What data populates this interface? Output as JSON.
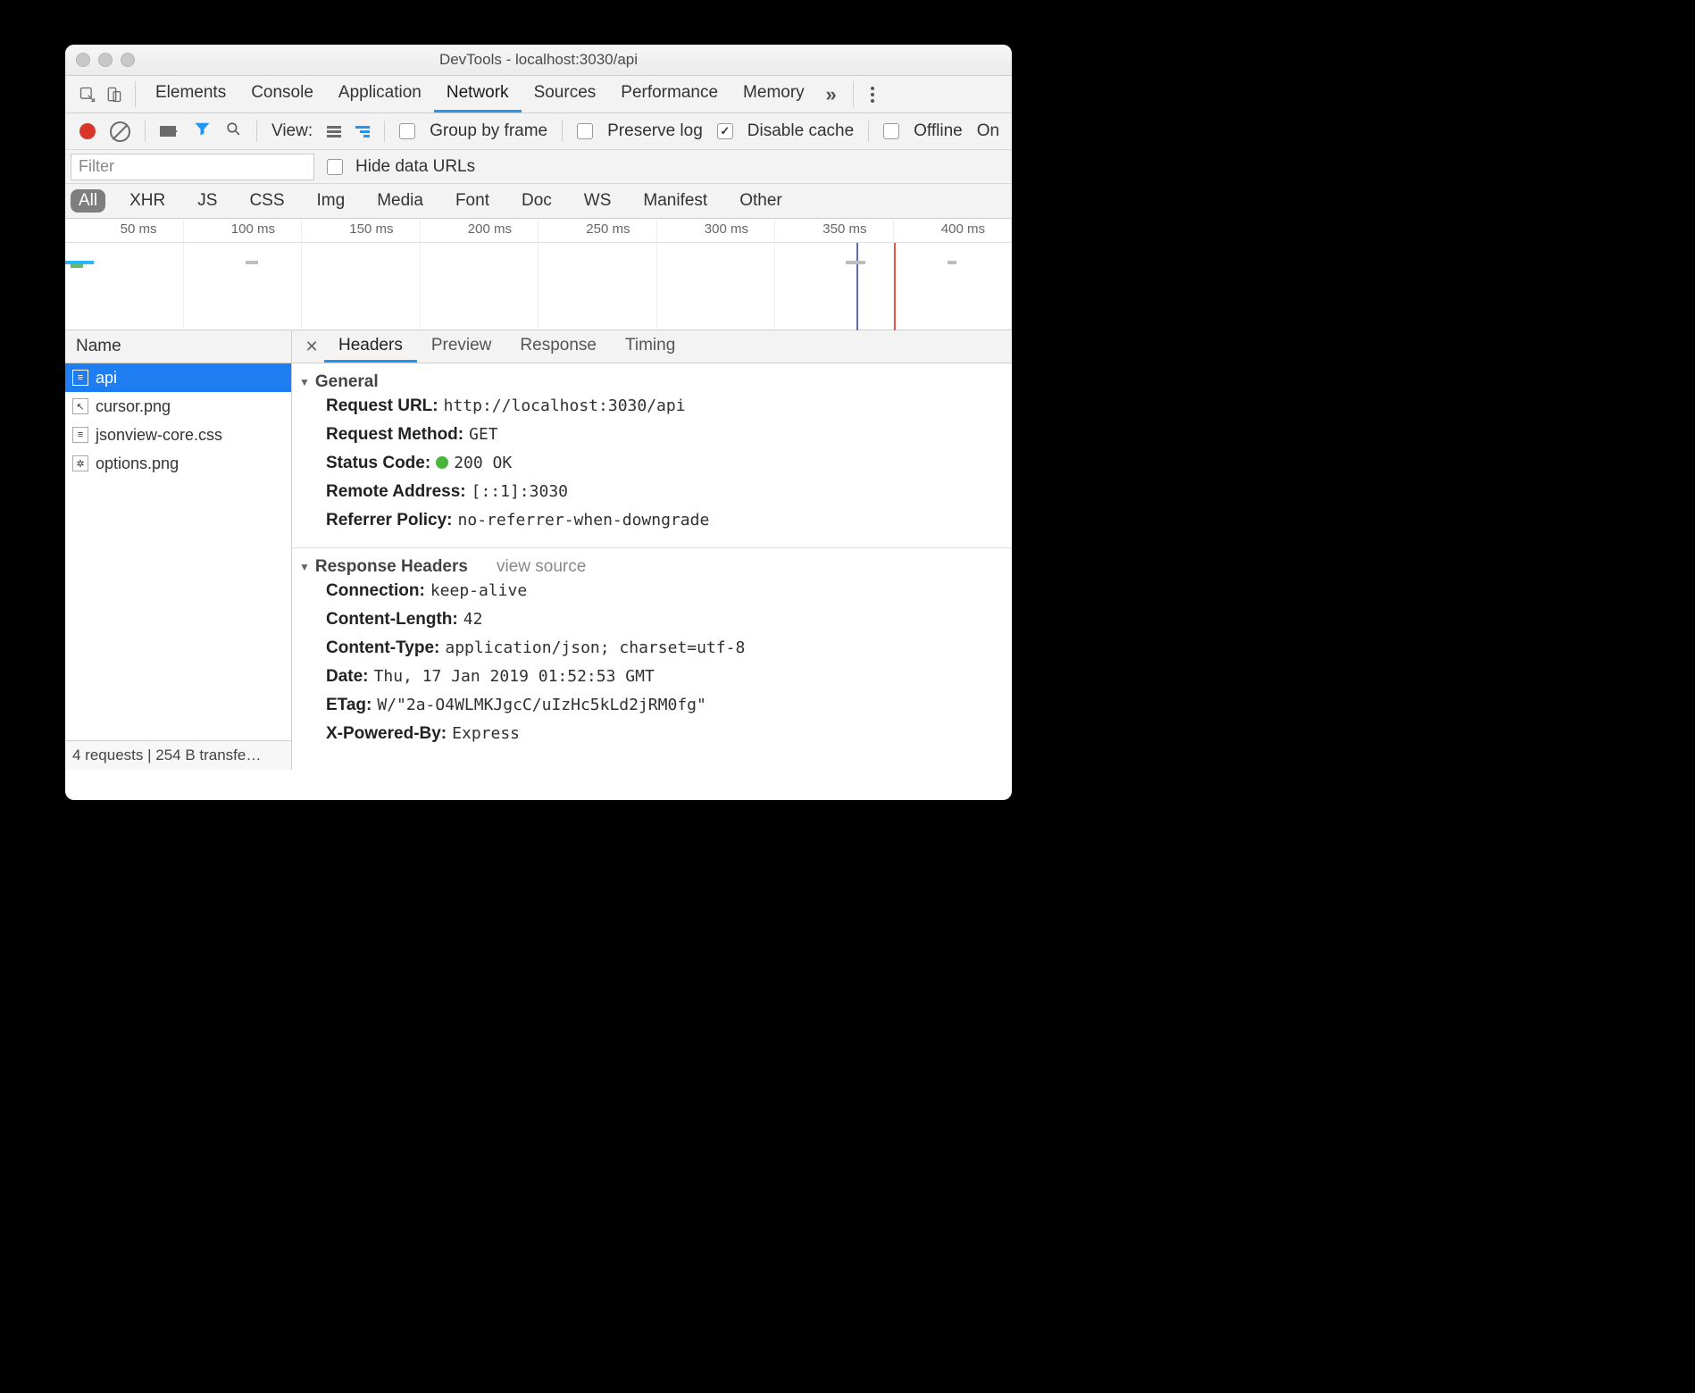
{
  "window": {
    "title": "DevTools - localhost:3030/api"
  },
  "toptabs": {
    "items": [
      "Elements",
      "Console",
      "Application",
      "Network",
      "Sources",
      "Performance",
      "Memory"
    ],
    "active": 3
  },
  "toolbar": {
    "view_label": "View:",
    "group_by_frame": "Group by frame",
    "preserve_log": "Preserve log",
    "disable_cache": "Disable cache",
    "offline": "Offline",
    "online": "On"
  },
  "filter": {
    "placeholder": "Filter",
    "hide_data_urls": "Hide data URLs"
  },
  "types": {
    "items": [
      "All",
      "XHR",
      "JS",
      "CSS",
      "Img",
      "Media",
      "Font",
      "Doc",
      "WS",
      "Manifest",
      "Other"
    ],
    "active": 0
  },
  "timeline": {
    "ticks": [
      "50 ms",
      "100 ms",
      "150 ms",
      "200 ms",
      "250 ms",
      "300 ms",
      "350 ms",
      "400 ms"
    ]
  },
  "leftpanel": {
    "header": "Name",
    "rows": [
      {
        "icon": "doc",
        "name": "api"
      },
      {
        "icon": "cursor",
        "name": "cursor.png"
      },
      {
        "icon": "doc",
        "name": "jsonview-core.css"
      },
      {
        "icon": "gear",
        "name": "options.png"
      }
    ],
    "selected": 0,
    "footer": "4 requests | 254 B transfe…"
  },
  "detail_tabs": {
    "items": [
      "Headers",
      "Preview",
      "Response",
      "Timing"
    ],
    "active": 0
  },
  "headers": {
    "general_title": "General",
    "general": {
      "request_url_k": "Request URL:",
      "request_url_v": "http://localhost:3030/api",
      "request_method_k": "Request Method:",
      "request_method_v": "GET",
      "status_code_k": "Status Code:",
      "status_code_v": "200 OK",
      "remote_addr_k": "Remote Address:",
      "remote_addr_v": "[::1]:3030",
      "referrer_policy_k": "Referrer Policy:",
      "referrer_policy_v": "no-referrer-when-downgrade"
    },
    "response_title": "Response Headers",
    "view_source": "view source",
    "response": {
      "connection_k": "Connection:",
      "connection_v": "keep-alive",
      "content_length_k": "Content-Length:",
      "content_length_v": "42",
      "content_type_k": "Content-Type:",
      "content_type_v": "application/json; charset=utf-8",
      "date_k": "Date:",
      "date_v": "Thu, 17 Jan 2019 01:52:53 GMT",
      "etag_k": "ETag:",
      "etag_v": "W/\"2a-O4WLMKJgcC/uIzHc5kLd2jRM0fg\"",
      "xpb_k": "X-Powered-By:",
      "xpb_v": "Express"
    }
  }
}
